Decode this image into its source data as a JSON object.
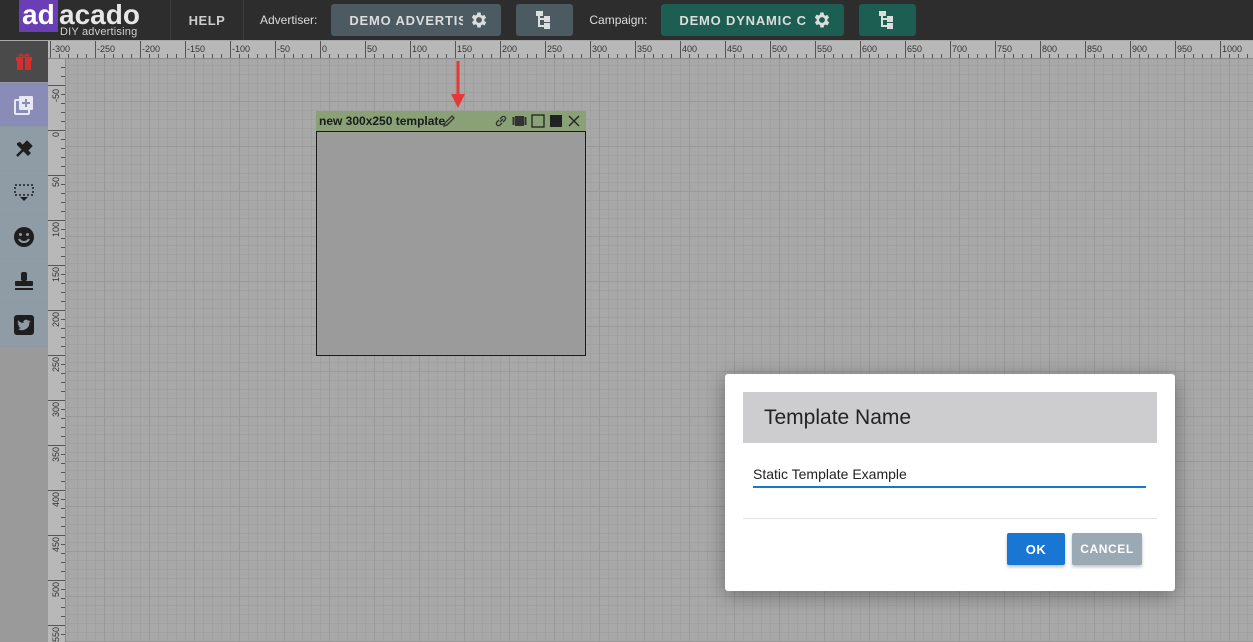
{
  "brand": {
    "logo_ad": "ad",
    "logo_rest": "acado",
    "tagline": "DIY advertising",
    "accent": "#6a3fb5"
  },
  "topbar": {
    "help": "HELP",
    "advertiser_label": "Advertiser:",
    "advertiser_value": "DEMO ADVERTISER",
    "campaign_label": "Campaign:",
    "campaign_value": "DEMO DYNAMIC C..."
  },
  "sidebar": {
    "items": [
      {
        "icon": "gift-icon"
      },
      {
        "icon": "add-layer-icon"
      },
      {
        "icon": "tools-icon"
      },
      {
        "icon": "dropdown-area-icon"
      },
      {
        "icon": "smiley-icon"
      },
      {
        "icon": "stamp-icon"
      },
      {
        "icon": "twitter-icon"
      }
    ]
  },
  "rulers": {
    "horizontal": [
      "-300",
      "-250",
      "-200",
      "-150",
      "-100",
      "-50",
      "0",
      "50",
      "100",
      "150",
      "200",
      "250",
      "300",
      "350",
      "400",
      "450",
      "500",
      "550",
      "600",
      "650",
      "700",
      "750",
      "800",
      "850",
      "900",
      "950",
      "1000"
    ],
    "vertical": [
      "-50",
      "0",
      "50",
      "100",
      "150",
      "200",
      "250",
      "300",
      "350",
      "400",
      "450",
      "500",
      "550"
    ]
  },
  "template": {
    "title": "new 300x250 template",
    "icons": [
      "pencil-icon",
      "link-icon",
      "film-icon",
      "square-outline-icon",
      "square-filled-icon",
      "close-icon"
    ]
  },
  "dialog": {
    "title": "Template Name",
    "input_value": "Static Template Example",
    "ok": "OK",
    "cancel": "CANCEL"
  },
  "colors": {
    "primary": "#1976d2",
    "annotation_arrow": "#e53935"
  }
}
